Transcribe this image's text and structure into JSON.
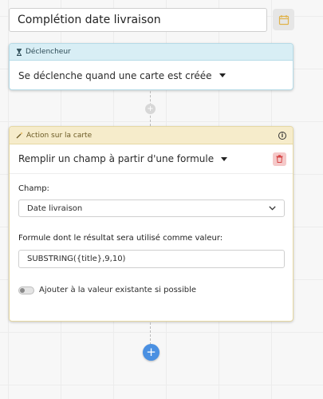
{
  "workflow": {
    "title": "Complétion date livraison"
  },
  "trigger": {
    "header_label": "Déclencheur",
    "header_icon": "hourglass-icon",
    "selected": "Se déclenche quand une carte est créée"
  },
  "action": {
    "header_label": "Action sur la carte",
    "header_icon": "wand-icon",
    "selected": "Remplir un champ à partir d'une formule",
    "field_label": "Champ:",
    "field_value": "Date livraison",
    "formula_label": "Formule dont le résultat sera utilisé comme valeur:",
    "formula_value": "SUBSTRING({title},9,10)",
    "toggle_label": "Ajouter à la valeur existante si possible",
    "toggle_on": false
  },
  "connectors": {
    "mini_add": "+",
    "add": "+"
  },
  "colors": {
    "trigger_header": "#d8eef5",
    "action_header": "#f6eccb",
    "add_button": "#4a90e2",
    "delete_button": "#f5c9c9"
  }
}
